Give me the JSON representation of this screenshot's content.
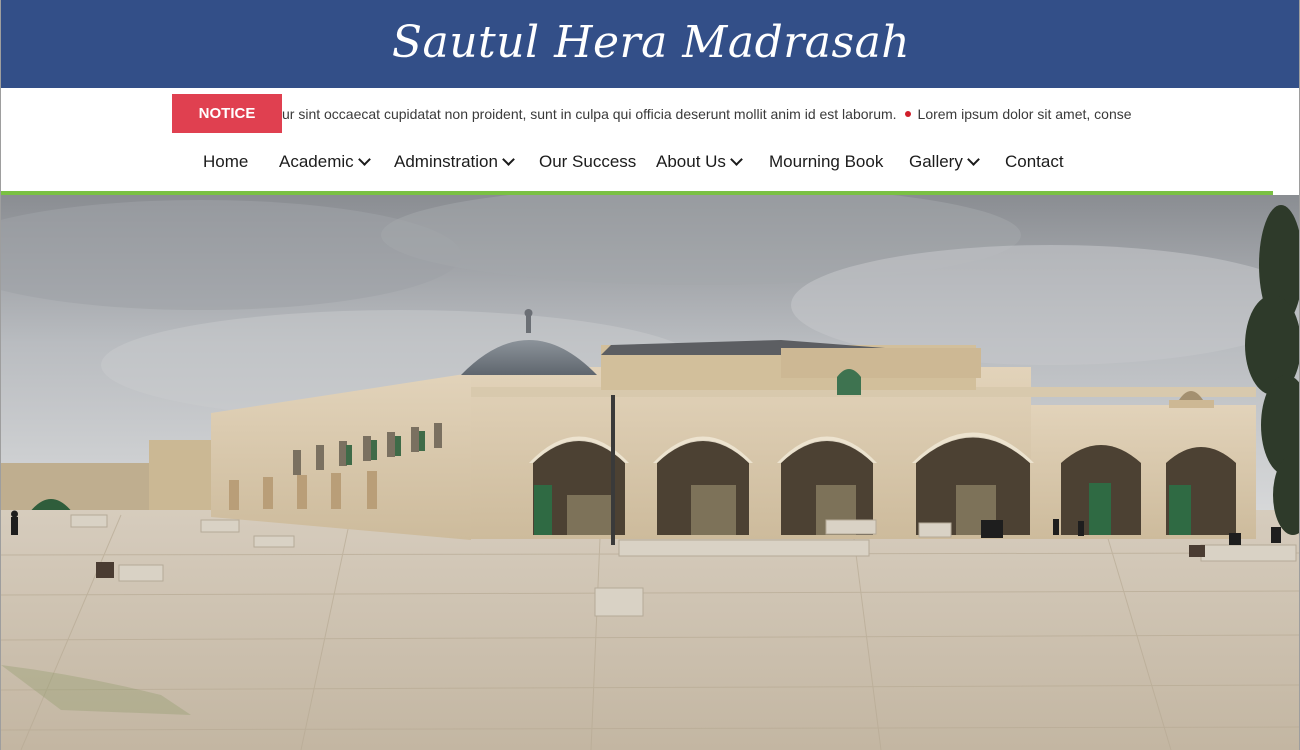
{
  "site": {
    "title": "Sautul Hera Madrasah"
  },
  "notice": {
    "badge_label": "NOTICE",
    "items": [
      "ur sint occaecat cupidatat non proident, sunt in culpa qui officia deserunt mollit anim id est laborum.",
      "Lorem ipsum dolor sit amet, consec"
    ]
  },
  "nav": {
    "items": [
      {
        "label": "Home",
        "has_dropdown": false
      },
      {
        "label": "Academic",
        "has_dropdown": true
      },
      {
        "label": "Adminstration",
        "has_dropdown": true
      },
      {
        "label": "Our Success",
        "has_dropdown": false
      },
      {
        "label": "About Us",
        "has_dropdown": true
      },
      {
        "label": "Mourning Book",
        "has_dropdown": false
      },
      {
        "label": "Gallery",
        "has_dropdown": true
      },
      {
        "label": "Contact",
        "has_dropdown": false
      }
    ]
  },
  "colors": {
    "header_bg": "#334f88",
    "notice_badge": "#e04050",
    "accent_line": "#7ac043",
    "ticker_dot": "#d01e2a"
  },
  "hero": {
    "image": "mosque-courtyard-photo"
  }
}
